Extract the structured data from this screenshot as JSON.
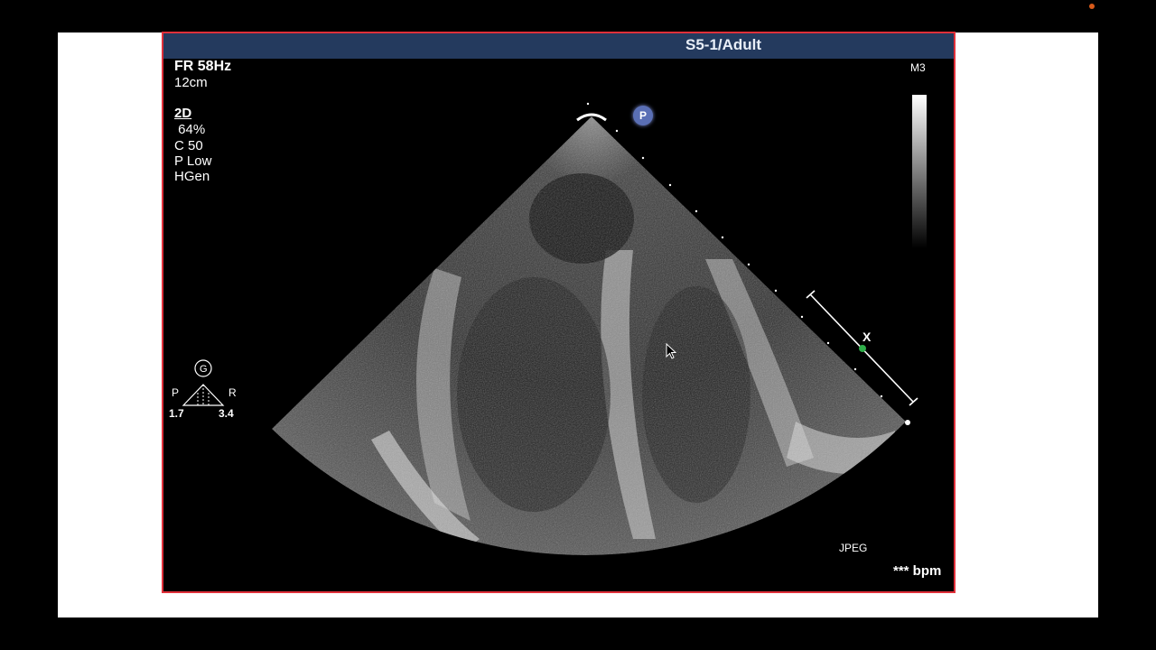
{
  "screen": {
    "probe_title": "S5-1/Adult",
    "frame_rate": "FR 58Hz",
    "depth": "12cm",
    "mode": "2D",
    "gain": " 64%",
    "compression": "C 50",
    "power": "P Low",
    "harmonic": "HGen",
    "map": "M3",
    "format": "JPEG",
    "heart_rate": "*** bpm",
    "probe_marker": "P",
    "orientation": {
      "top_label": "G",
      "left_label": "P",
      "right_label": "R",
      "left_value": "1.7",
      "right_value": "3.4"
    },
    "scale_marker": "X"
  },
  "colors": {
    "header_bar": "#243a5e",
    "frame_border": "#e0303a",
    "marker_dot": "#2fae4a",
    "recording_dot": "#d85a1a"
  }
}
